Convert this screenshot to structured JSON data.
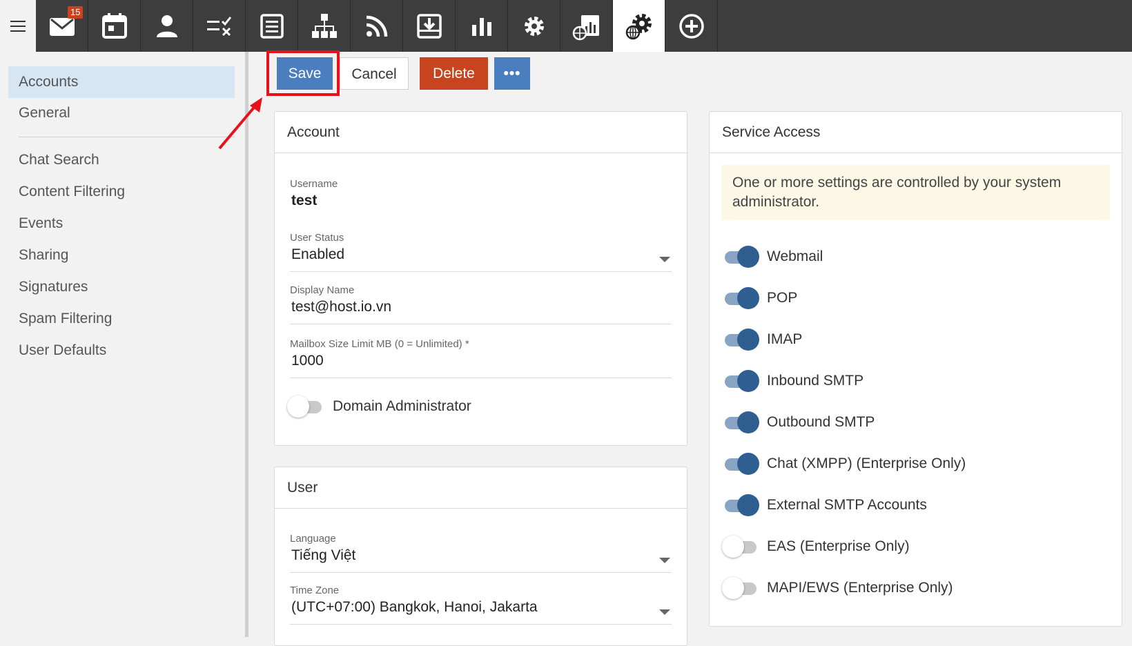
{
  "toolbar": {
    "mail_badge": "15",
    "icons": [
      "mail-icon",
      "calendar-icon",
      "contacts-icon",
      "tasks-icon",
      "notes-icon",
      "org-chart-icon",
      "rss-icon",
      "archive-icon",
      "reports-icon",
      "settings-icon",
      "domain-reports-icon",
      "domain-settings-icon",
      "add-icon"
    ],
    "active": "domain-settings-icon"
  },
  "sidebar": {
    "items": [
      {
        "label": "Accounts",
        "active": true
      },
      {
        "label": "General"
      },
      {
        "label": "Chat Search"
      },
      {
        "label": "Content Filtering"
      },
      {
        "label": "Events"
      },
      {
        "label": "Sharing"
      },
      {
        "label": "Signatures"
      },
      {
        "label": "Spam Filtering"
      },
      {
        "label": "User Defaults"
      }
    ]
  },
  "actions": {
    "save": "Save",
    "cancel": "Cancel",
    "delete": "Delete",
    "more": "•••"
  },
  "account_panel": {
    "title": "Account",
    "username_label": "Username",
    "username_value": "test",
    "status_label": "User Status",
    "status_value": "Enabled",
    "display_name_label": "Display Name",
    "display_name_value": "test@host.io.vn",
    "mailbox_label": "Mailbox Size Limit MB (0 = Unlimited) *",
    "mailbox_value": "1000",
    "domain_admin_label": "Domain Administrator",
    "domain_admin_on": false
  },
  "user_panel": {
    "title": "User",
    "language_label": "Language",
    "language_value": "Tiếng Việt",
    "timezone_label": "Time Zone",
    "timezone_value": "(UTC+07:00) Bangkok, Hanoi, Jakarta"
  },
  "service_panel": {
    "title": "Service Access",
    "notice": "One or more settings are controlled by your system administrator.",
    "services": [
      {
        "label": "Webmail",
        "on": true
      },
      {
        "label": "POP",
        "on": true
      },
      {
        "label": "IMAP",
        "on": true
      },
      {
        "label": "Inbound SMTP",
        "on": true
      },
      {
        "label": "Outbound SMTP",
        "on": true
      },
      {
        "label": "Chat (XMPP) (Enterprise Only)",
        "on": true
      },
      {
        "label": "External SMTP Accounts",
        "on": true
      },
      {
        "label": "EAS (Enterprise Only)",
        "on": false
      },
      {
        "label": "MAPI/EWS (Enterprise Only)",
        "on": false
      }
    ]
  },
  "colors": {
    "primary": "#4a7ebf",
    "danger": "#c8441f",
    "topbar": "#3d3d3d",
    "highlight": "#e8101a"
  }
}
